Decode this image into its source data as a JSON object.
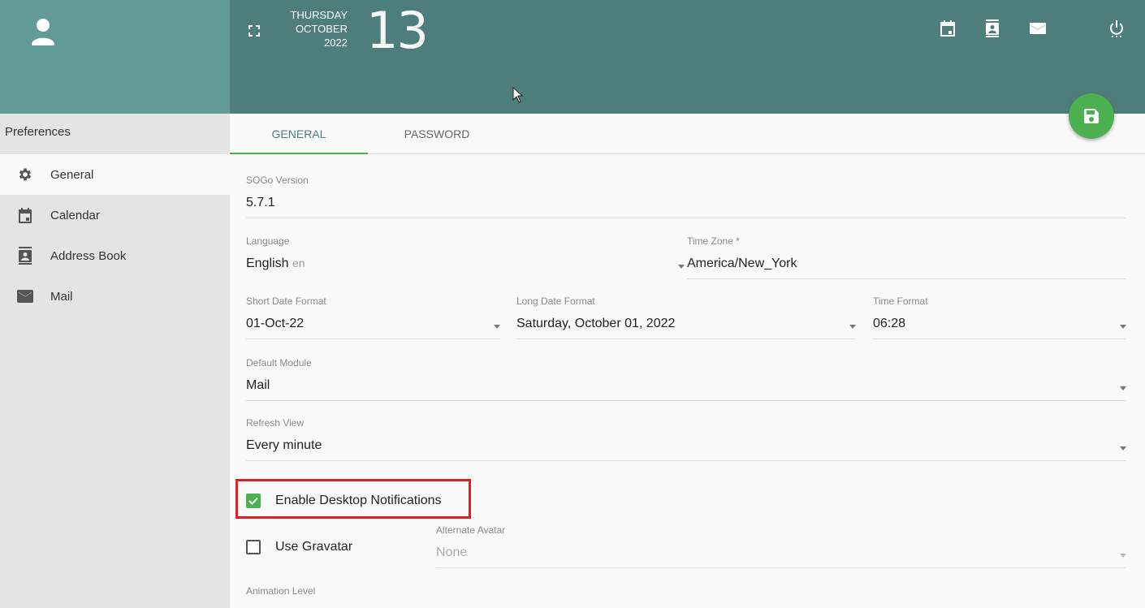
{
  "sidebar": {
    "title": "Preferences",
    "items": [
      {
        "label": "General",
        "icon": "gear-icon"
      },
      {
        "label": "Calendar",
        "icon": "calendar-icon"
      },
      {
        "label": "Address Book",
        "icon": "address-book-icon"
      },
      {
        "label": "Mail",
        "icon": "mail-icon"
      }
    ]
  },
  "header": {
    "weekday": "THURSDAY",
    "month": "OCTOBER",
    "year": "2022",
    "day": "13",
    "icons": [
      "calendar-icon",
      "address-book-icon",
      "mail-icon",
      "power-icon"
    ]
  },
  "tabs": [
    {
      "label": "GENERAL",
      "active": true
    },
    {
      "label": "PASSWORD",
      "active": false
    }
  ],
  "form": {
    "version": {
      "label": "SOGo Version",
      "value": "5.7.1"
    },
    "language": {
      "label": "Language",
      "value": "English",
      "code": "en"
    },
    "timezone": {
      "label": "Time Zone *",
      "value": "America/New_York"
    },
    "short_date": {
      "label": "Short Date Format",
      "value": "01-Oct-22"
    },
    "long_date": {
      "label": "Long Date Format",
      "value": "Saturday, October 01, 2022"
    },
    "time_format": {
      "label": "Time Format",
      "value": "06:28"
    },
    "default_module": {
      "label": "Default Module",
      "value": "Mail"
    },
    "refresh_view": {
      "label": "Refresh View",
      "value": "Every minute"
    },
    "desktop_notifications": {
      "label": "Enable Desktop Notifications",
      "checked": true
    },
    "gravatar": {
      "label": "Use Gravatar",
      "checked": false
    },
    "alternate_avatar": {
      "label": "Alternate Avatar",
      "value": "None"
    },
    "animation_level": {
      "label": "Animation Level"
    }
  },
  "colors": {
    "accent": "#4caf50",
    "header": "#4e7e7b",
    "sidebar_header": "#619a96",
    "highlight": "#e02027"
  }
}
